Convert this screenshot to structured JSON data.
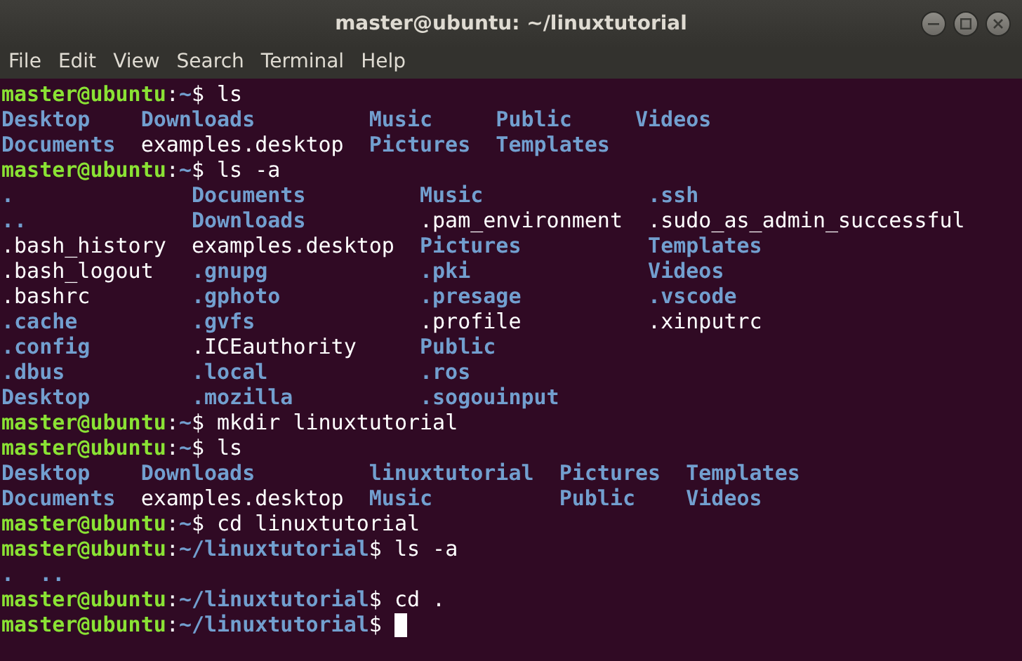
{
  "window": {
    "title": "master@ubuntu: ~/linuxtutorial"
  },
  "menu": [
    "File",
    "Edit",
    "View",
    "Search",
    "Terminal",
    "Help"
  ],
  "lines": [
    {
      "kind": "prompt",
      "host": "master@ubuntu",
      "sep": ":",
      "path": "~",
      "command": "$ ls",
      "cursor": false
    },
    {
      "kind": "listing",
      "rows": [
        [
          {
            "text": "Desktop",
            "kind": "dir"
          },
          {
            "text": "Downloads",
            "kind": "dir"
          },
          {
            "text": "Music",
            "kind": "dir"
          },
          {
            "text": "Public",
            "kind": "dir"
          },
          {
            "text": "Videos",
            "kind": "dir"
          }
        ],
        [
          {
            "text": "Documents",
            "kind": "dir"
          },
          {
            "text": "examples.desktop",
            "kind": "file"
          },
          {
            "text": "Pictures",
            "kind": "dir"
          },
          {
            "text": "Templates",
            "kind": "dir"
          }
        ]
      ]
    },
    {
      "kind": "prompt",
      "host": "master@ubuntu",
      "sep": ":",
      "path": "~",
      "command": "$ ls -a",
      "cursor": false
    },
    {
      "kind": "listing",
      "rows": [
        [
          {
            "text": ".",
            "kind": "dir"
          },
          {
            "text": "Documents",
            "kind": "dir"
          },
          {
            "text": "Music",
            "kind": "dir"
          },
          {
            "text": ".ssh",
            "kind": "dir"
          }
        ],
        [
          {
            "text": "..",
            "kind": "dir"
          },
          {
            "text": "Downloads",
            "kind": "dir"
          },
          {
            "text": ".pam_environment",
            "kind": "file"
          },
          {
            "text": ".sudo_as_admin_successful",
            "kind": "file"
          }
        ],
        [
          {
            "text": ".bash_history",
            "kind": "file"
          },
          {
            "text": "examples.desktop",
            "kind": "file"
          },
          {
            "text": "Pictures",
            "kind": "dir"
          },
          {
            "text": "Templates",
            "kind": "dir"
          }
        ],
        [
          {
            "text": ".bash_logout",
            "kind": "file"
          },
          {
            "text": ".gnupg",
            "kind": "dir"
          },
          {
            "text": ".pki",
            "kind": "dir"
          },
          {
            "text": "Videos",
            "kind": "dir"
          }
        ],
        [
          {
            "text": ".bashrc",
            "kind": "file"
          },
          {
            "text": ".gphoto",
            "kind": "dir"
          },
          {
            "text": ".presage",
            "kind": "dir"
          },
          {
            "text": ".vscode",
            "kind": "dir"
          }
        ],
        [
          {
            "text": ".cache",
            "kind": "dir"
          },
          {
            "text": ".gvfs",
            "kind": "dir"
          },
          {
            "text": ".profile",
            "kind": "file"
          },
          {
            "text": ".xinputrc",
            "kind": "file"
          }
        ],
        [
          {
            "text": ".config",
            "kind": "dir"
          },
          {
            "text": ".ICEauthority",
            "kind": "file"
          },
          {
            "text": "Public",
            "kind": "dir"
          }
        ],
        [
          {
            "text": ".dbus",
            "kind": "dir"
          },
          {
            "text": ".local",
            "kind": "dir"
          },
          {
            "text": ".ros",
            "kind": "dir"
          }
        ],
        [
          {
            "text": "Desktop",
            "kind": "dir"
          },
          {
            "text": ".mozilla",
            "kind": "dir"
          },
          {
            "text": ".sogouinput",
            "kind": "dir"
          }
        ]
      ]
    },
    {
      "kind": "prompt",
      "host": "master@ubuntu",
      "sep": ":",
      "path": "~",
      "command": "$ mkdir linuxtutorial",
      "cursor": false
    },
    {
      "kind": "prompt",
      "host": "master@ubuntu",
      "sep": ":",
      "path": "~",
      "command": "$ ls",
      "cursor": false
    },
    {
      "kind": "listing",
      "rows": [
        [
          {
            "text": "Desktop",
            "kind": "dir"
          },
          {
            "text": "Downloads",
            "kind": "dir"
          },
          {
            "text": "linuxtutorial",
            "kind": "dir"
          },
          {
            "text": "Pictures",
            "kind": "dir"
          },
          {
            "text": "Templates",
            "kind": "dir"
          }
        ],
        [
          {
            "text": "Documents",
            "kind": "dir"
          },
          {
            "text": "examples.desktop",
            "kind": "file"
          },
          {
            "text": "Music",
            "kind": "dir"
          },
          {
            "text": "Public",
            "kind": "dir"
          },
          {
            "text": "Videos",
            "kind": "dir"
          }
        ]
      ]
    },
    {
      "kind": "prompt",
      "host": "master@ubuntu",
      "sep": ":",
      "path": "~",
      "command": "$ cd linuxtutorial",
      "cursor": false
    },
    {
      "kind": "prompt",
      "host": "master@ubuntu",
      "sep": ":",
      "path": "~/linuxtutorial",
      "command": "$ ls -a",
      "cursor": false
    },
    {
      "kind": "listing",
      "rows": [
        [
          {
            "text": ".",
            "kind": "dir"
          },
          {
            "text": "..",
            "kind": "dir"
          }
        ]
      ]
    },
    {
      "kind": "prompt",
      "host": "master@ubuntu",
      "sep": ":",
      "path": "~/linuxtutorial",
      "command": "$ cd .",
      "cursor": false
    },
    {
      "kind": "prompt",
      "host": "master@ubuntu",
      "sep": ":",
      "path": "~/linuxtutorial",
      "command": "$",
      "cursor": true
    }
  ]
}
